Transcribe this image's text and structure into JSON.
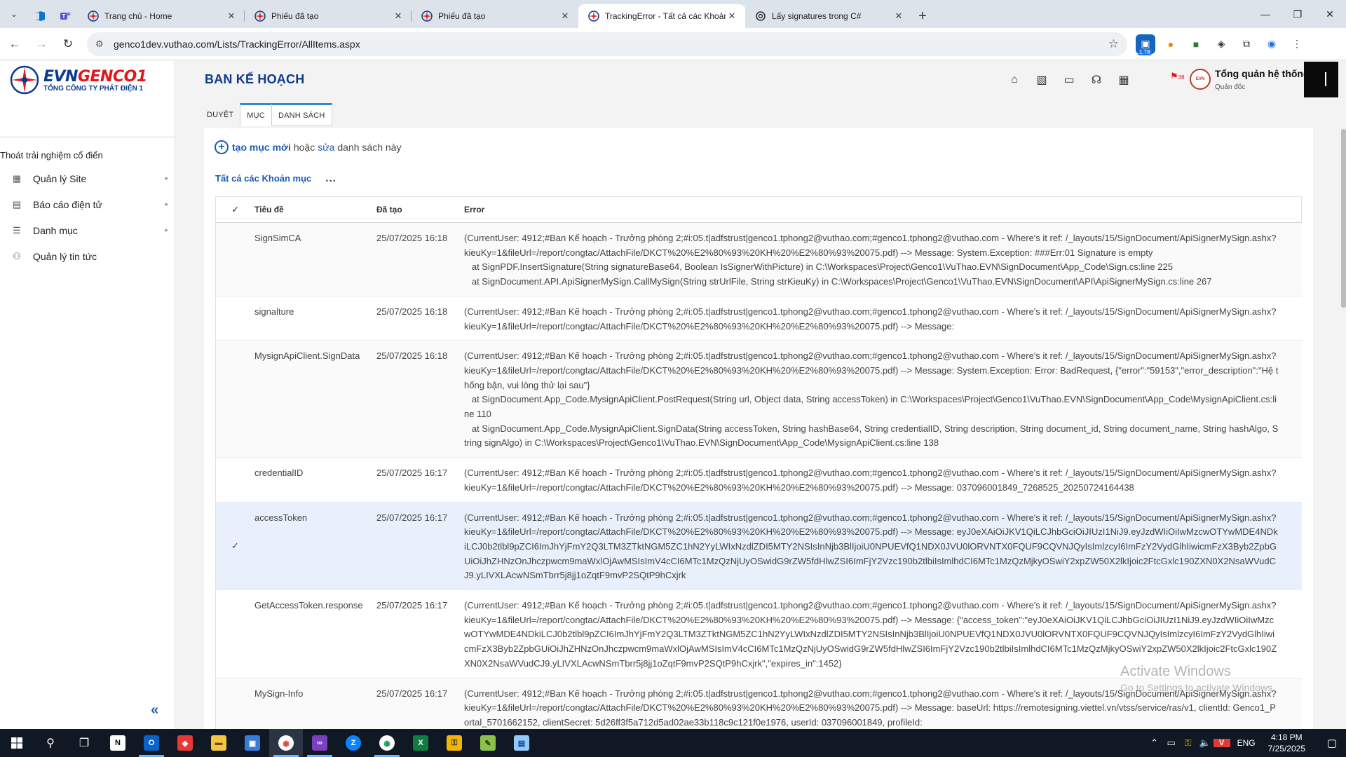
{
  "browser": {
    "tabs": [
      {
        "title": "Trang chủ - Home",
        "active": false
      },
      {
        "title": "Phiếu đã tạo",
        "active": false
      },
      {
        "title": "Phiếu đã tạo",
        "active": false
      },
      {
        "title": "TrackingError - Tất cả các Khoản",
        "active": true
      },
      {
        "title": "Lấy signatures trong C#",
        "active": false
      }
    ],
    "url": "genco1dev.vuthao.com/Lists/TrackingError/AllItems.aspx",
    "extension_badge": "1.78"
  },
  "logo": {
    "brand_evn": "EVN",
    "brand_genco": "GENCO1",
    "subtitle": "TỔNG CÔNG TY PHÁT ĐIỆN 1"
  },
  "sidebar": {
    "classic_link": "Thoát trải nghiệm cổ điển",
    "items": [
      {
        "label": "Quản lý Site",
        "icon": "site-icon"
      },
      {
        "label": "Báo cáo điện tử",
        "icon": "report-icon"
      },
      {
        "label": "Danh mục",
        "icon": "menu-icon"
      },
      {
        "label": "Quản lý tin tức",
        "icon": "news-icon"
      }
    ],
    "collapse": "«"
  },
  "header": {
    "site_title": "BAN KẾ HOẠCH",
    "user_name": "Tổng quản hệ thống",
    "user_role": "Quản đốc",
    "flag_badge": "38"
  },
  "ribbon": {
    "tabs": [
      "DUYỆT",
      "MỤC",
      "DANH SÁCH"
    ]
  },
  "list": {
    "new_item_link": "tạo mục mới",
    "or_text": "hoặc",
    "edit_link": "sửa",
    "list_text": "danh sách này",
    "view_name": "Tất cả các Khoản mục",
    "more": "...",
    "columns": {
      "check": "✓",
      "title": "Tiêu đề",
      "created": "Đã tạo",
      "error": "Error"
    },
    "rows": [
      {
        "title": "SignSimCA",
        "created": "25/07/2025 16:18",
        "error": "(CurrentUser: 4912;#Ban Kế hoạch - Trưởng phòng 2;#i:05.t|adfstrust|genco1.tphong2@vuthao.com;#genco1.tphong2@vuthao.com - Where's it ref: /_layouts/15/SignDocument/ApiSignerMySign.ashx?kieuKy=1&fileUrl=/report/congtac/AttachFile/DKCT%20%E2%80%93%20KH%20%E2%80%93%20075.pdf) --> Message: System.Exception: ###Err:01 Signature is empty\n   at SignPDF.InsertSignature(String signatureBase64, Boolean IsSignerWithPicture) in C:\\Workspaces\\Project\\Genco1\\VuThao.EVN\\SignDocument\\App_Code\\Sign.cs:line 225\n   at SignDocument.API.ApiSignerMySign.CallMySign(String strUrlFile, String strKieuKy) in C:\\Workspaces\\Project\\Genco1\\VuThao.EVN\\SignDocument\\API\\ApiSignerMySign.cs:line 267",
        "selected": false
      },
      {
        "title": "signalture",
        "created": "25/07/2025 16:18",
        "error": "(CurrentUser: 4912;#Ban Kế hoạch - Trưởng phòng 2;#i:05.t|adfstrust|genco1.tphong2@vuthao.com;#genco1.tphong2@vuthao.com - Where's it ref: /_layouts/15/SignDocument/ApiSignerMySign.ashx?kieuKy=1&fileUrl=/report/congtac/AttachFile/DKCT%20%E2%80%93%20KH%20%E2%80%93%20075.pdf) --> Message:",
        "selected": false
      },
      {
        "title": "MysignApiClient.SignData",
        "created": "25/07/2025 16:18",
        "error": "(CurrentUser: 4912;#Ban Kế hoạch - Trưởng phòng 2;#i:05.t|adfstrust|genco1.tphong2@vuthao.com;#genco1.tphong2@vuthao.com - Where's it ref: /_layouts/15/SignDocument/ApiSignerMySign.ashx?kieuKy=1&fileUrl=/report/congtac/AttachFile/DKCT%20%E2%80%93%20KH%20%E2%80%93%20075.pdf) --> Message: System.Exception: Error: BadRequest, {\"error\":\"59153\",\"error_description\":\"Hệ thống bận, vui lòng thử lại sau\"}\n   at SignDocument.App_Code.MysignApiClient.PostRequest(String url, Object data, String accessToken) in C:\\Workspaces\\Project\\Genco1\\VuThao.EVN\\SignDocument\\App_Code\\MysignApiClient.cs:line 110\n   at SignDocument.App_Code.MysignApiClient.SignData(String accessToken, String hashBase64, String credentialID, String description, String document_id, String document_name, String hashAlgo, String signAlgo) in C:\\Workspaces\\Project\\Genco1\\VuThao.EVN\\SignDocument\\App_Code\\MysignApiClient.cs:line 138",
        "selected": false
      },
      {
        "title": "credentialID",
        "created": "25/07/2025 16:17",
        "error": "(CurrentUser: 4912;#Ban Kế hoạch - Trưởng phòng 2;#i:05.t|adfstrust|genco1.tphong2@vuthao.com;#genco1.tphong2@vuthao.com - Where's it ref: /_layouts/15/SignDocument/ApiSignerMySign.ashx?kieuKy=1&fileUrl=/report/congtac/AttachFile/DKCT%20%E2%80%93%20KH%20%E2%80%93%20075.pdf) --> Message: 037096001849_7268525_20250724164438",
        "selected": false
      },
      {
        "title": "accessToken",
        "created": "25/07/2025 16:17",
        "error": "(CurrentUser: 4912;#Ban Kế hoạch - Trưởng phòng 2;#i:05.t|adfstrust|genco1.tphong2@vuthao.com;#genco1.tphong2@vuthao.com - Where's it ref: /_layouts/15/SignDocument/ApiSignerMySign.ashx?kieuKy=1&fileUrl=/report/congtac/AttachFile/DKCT%20%E2%80%93%20KH%20%E2%80%93%20075.pdf) --> Message: eyJ0eXAiOiJKV1QiLCJhbGciOiJIUzI1NiJ9.eyJzdWIiOiIwMzcwOTYwMDE4NDkiLCJ0b2tlbl9pZCI6ImJhYjFmY2Q3LTM3ZTktNGM5ZC1hN2YyLWIxNzdlZDI5MTY2NSIsInNjb3BlIjoiU0NPUEVfQ1NDX0JVU0lORVNTX0FQUF9CQVNJQyIsImlzcyI6ImFzY2VydGlhIiwicmFzX3Byb2ZpbGUiOiJhZHNzOnJhczpwcm9maWxlOjAwMSIsImV4cCI6MTc1MzQzNjUyOSwidG9rZW5fdHlwZSI6ImFjY2Vzc190b2tlbiIsImlhdCI6MTc1MzQzMjkyOSwiY2xpZW50X2lkIjoic2FtcGxlc190ZXN0X2NsaWVudCJ9.yLIVXLAcwNSmTbrr5j8jj1oZqtF9mvP2SQtP9hCxjrk",
        "selected": true
      },
      {
        "title": "GetAccessToken.response",
        "created": "25/07/2025 16:17",
        "error": "(CurrentUser: 4912;#Ban Kế hoạch - Trưởng phòng 2;#i:05.t|adfstrust|genco1.tphong2@vuthao.com;#genco1.tphong2@vuthao.com - Where's it ref: /_layouts/15/SignDocument/ApiSignerMySign.ashx?kieuKy=1&fileUrl=/report/congtac/AttachFile/DKCT%20%E2%80%93%20KH%20%E2%80%93%20075.pdf) --> Message: {\"access_token\":\"eyJ0eXAiOiJKV1QiLCJhbGciOiJIUzI1NiJ9.eyJzdWIiOiIwMzcwOTYwMDE4NDkiLCJ0b2tlbl9pZCI6ImJhYjFmY2Q3LTM3ZTktNGM5ZC1hN2YyLWIxNzdlZDI5MTY2NSIsInNjb3BlIjoiU0NPUEVfQ1NDX0JVU0lORVNTX0FQUF9CQVNJQyIsImlzcyI6ImFzY2VydGlhIiwicmFzX3Byb2ZpbGUiOiJhZHNzOnJhczpwcm9maWxlOjAwMSIsImV4cCI6MTc1MzQzNjUyOSwidG9rZW5fdHlwZSI6ImFjY2Vzc190b2tlbiIsImlhdCI6MTc1MzQzMjkyOSwiY2xpZW50X2lkIjoic2FtcGxlc190ZXN0X2NsaWVudCJ9.yLIVXLAcwNSmTbrr5j8jj1oZqtF9mvP2SQtP9hCxjrk\",\"expires_in\":1452}",
        "selected": false
      },
      {
        "title": "MySign-Info",
        "created": "25/07/2025 16:17",
        "error": "(CurrentUser: 4912;#Ban Kế hoạch - Trưởng phòng 2;#i:05.t|adfstrust|genco1.tphong2@vuthao.com;#genco1.tphong2@vuthao.com - Where's it ref: /_layouts/15/SignDocument/ApiSignerMySign.ashx?kieuKy=1&fileUrl=/report/congtac/AttachFile/DKCT%20%E2%80%93%20KH%20%E2%80%93%20075.pdf) --> Message: baseUrl: https://remotesigning.viettel.vn/vtss/service/ras/v1, clientId: Genco1_Portal_5701662152, clientSecret: 5d26ff3f5a712d5ad02ae33b118c9c121f0e1976, userId: 037096001849, profileId:",
        "selected": false
      }
    ]
  },
  "watermark": {
    "line1": "Activate Windows",
    "line2": "Go to Settings to activate Windows."
  },
  "taskbar": {
    "lang": "ENG",
    "time": "4:18 PM",
    "date": "7/25/2025"
  }
}
